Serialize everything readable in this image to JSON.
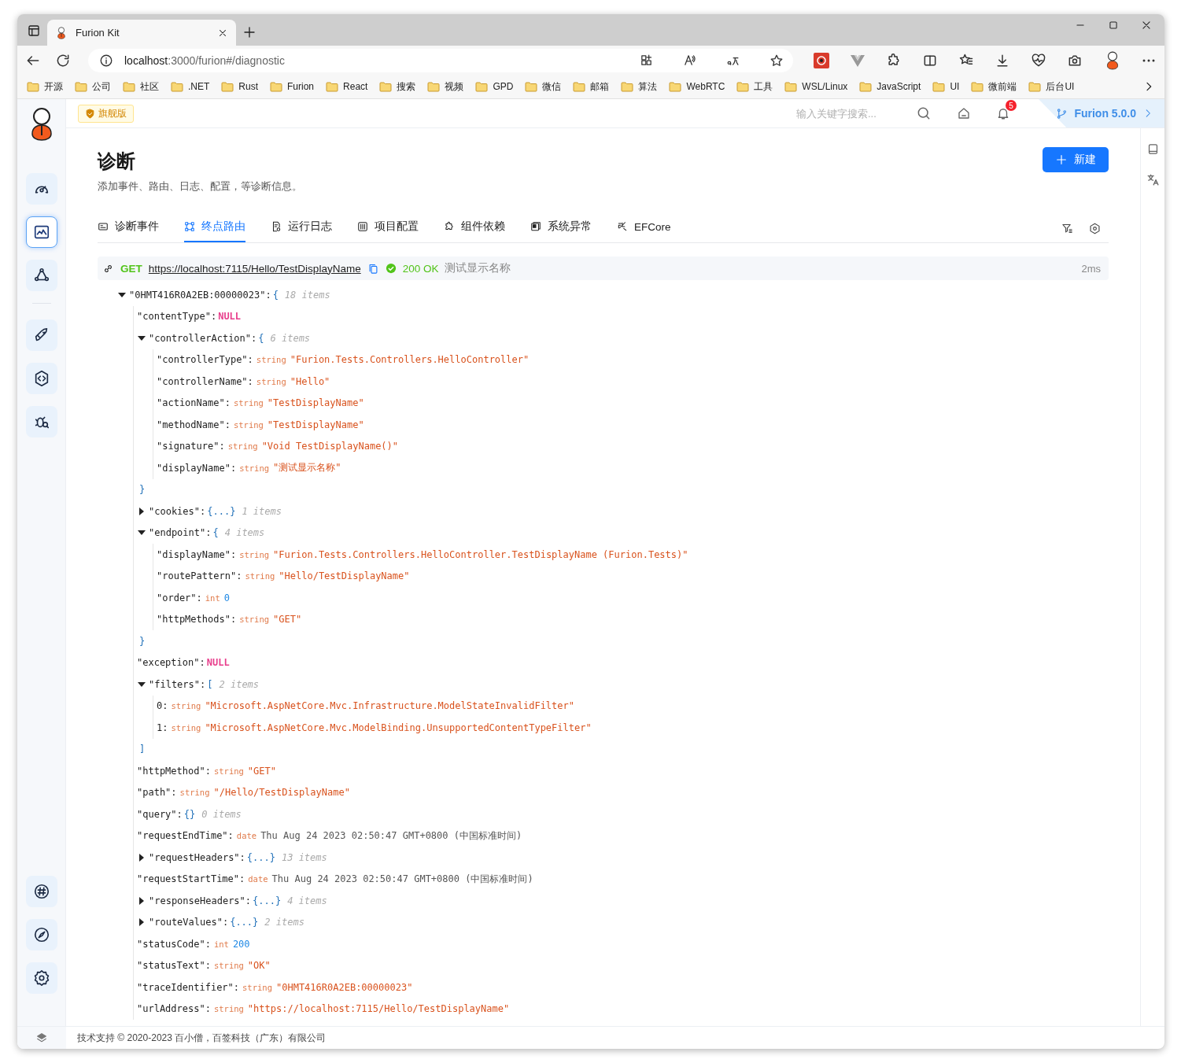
{
  "browser": {
    "tab_title": "Furion Kit",
    "address": {
      "host": "localhost",
      "path": ":3000/furion#/diagnostic"
    },
    "bookmarks": [
      "开源",
      "公司",
      "社区",
      ".NET",
      "Rust",
      "Furion",
      "React",
      "搜索",
      "视频",
      "GPD",
      "微信",
      "邮箱",
      "算法",
      "WebRTC",
      "工具",
      "WSL/Linux",
      "JavaScript",
      "UI",
      "微前端",
      "后台UI"
    ]
  },
  "sidebar": {
    "items": [
      {
        "kind": "gauge",
        "selected": false
      },
      {
        "kind": "chart",
        "selected": true
      },
      {
        "kind": "nodes",
        "selected": false
      },
      {
        "kind": "rocket",
        "selected": false
      },
      {
        "kind": "code",
        "selected": false
      },
      {
        "kind": "bug",
        "selected": false
      }
    ],
    "bottom_items": [
      {
        "kind": "hash",
        "selected": false
      },
      {
        "kind": "compass",
        "selected": false
      },
      {
        "kind": "gear",
        "selected": false
      }
    ]
  },
  "header": {
    "edition_badge": "旗舰版",
    "search": {
      "placeholder": "输入关键字搜索..."
    },
    "notification_count": "5",
    "version": "Furion 5.0.0"
  },
  "page": {
    "title": "诊断",
    "subtitle": "添加事件、路由、日志、配置，等诊断信息。",
    "new_button": "新建"
  },
  "tabs": [
    {
      "label": "诊断事件",
      "kind": "event",
      "selected": false
    },
    {
      "label": "终点路由",
      "kind": "route",
      "selected": true
    },
    {
      "label": "运行日志",
      "kind": "log",
      "selected": false
    },
    {
      "label": "项目配置",
      "kind": "config",
      "selected": false
    },
    {
      "label": "组件依赖",
      "kind": "puzzle",
      "selected": false
    },
    {
      "label": "系统异常",
      "kind": "error",
      "selected": false
    },
    {
      "label": "EFCore",
      "kind": "sql",
      "selected": false
    }
  ],
  "request": {
    "method": "GET",
    "url": "https://localhost:7115/Hello/TestDisplayName",
    "status": "200 OK",
    "name": "测试显示名称",
    "duration": "2ms"
  },
  "tree": {
    "key": "\"0HMT416R0A2EB:00000023\":",
    "kind": "object",
    "expanded": true,
    "open": "{",
    "count": "18 items",
    "children": [
      {
        "key": "\"contentType\":",
        "kind": "null",
        "value": "NULL"
      },
      {
        "key": "\"controllerAction\":",
        "kind": "object",
        "expanded": true,
        "open": "{",
        "count": "6 items",
        "close": "}",
        "children": [
          {
            "key": "\"controllerType\":",
            "kind": "string",
            "type": "string",
            "value": "\"Furion.Tests.Controllers.HelloController\""
          },
          {
            "key": "\"controllerName\":",
            "kind": "string",
            "type": "string",
            "value": "\"Hello\""
          },
          {
            "key": "\"actionName\":",
            "kind": "string",
            "type": "string",
            "value": "\"TestDisplayName\""
          },
          {
            "key": "\"methodName\":",
            "kind": "string",
            "type": "string",
            "value": "\"TestDisplayName\""
          },
          {
            "key": "\"signature\":",
            "kind": "string",
            "type": "string",
            "value": "\"Void TestDisplayName()\""
          },
          {
            "key": "\"displayName\":",
            "kind": "string",
            "type": "string",
            "value": "\"测试显示名称\""
          }
        ]
      },
      {
        "key": "\"cookies\":",
        "kind": "object",
        "expanded": false,
        "summary": "{...}",
        "count": "1 items"
      },
      {
        "key": "\"endpoint\":",
        "kind": "object",
        "expanded": true,
        "open": "{",
        "count": "4 items",
        "close": "}",
        "children": [
          {
            "key": "\"displayName\":",
            "kind": "string",
            "type": "string",
            "value": "\"Furion.Tests.Controllers.HelloController.TestDisplayName (Furion.Tests)\""
          },
          {
            "key": "\"routePattern\":",
            "kind": "string",
            "type": "string",
            "value": "\"Hello/TestDisplayName\""
          },
          {
            "key": "\"order\":",
            "kind": "int",
            "type": "int",
            "value": "0"
          },
          {
            "key": "\"httpMethods\":",
            "kind": "string",
            "type": "string",
            "value": "\"GET\""
          }
        ]
      },
      {
        "key": "\"exception\":",
        "kind": "null",
        "value": "NULL"
      },
      {
        "key": "\"filters\":",
        "kind": "array",
        "expanded": true,
        "open": "[",
        "count": "2 items",
        "close": "]",
        "children": [
          {
            "key": "0:",
            "kind": "string",
            "type": "string",
            "value": "\"Microsoft.AspNetCore.Mvc.Infrastructure.ModelStateInvalidFilter\""
          },
          {
            "key": "1:",
            "kind": "string",
            "type": "string",
            "value": "\"Microsoft.AspNetCore.Mvc.ModelBinding.UnsupportedContentTypeFilter\""
          }
        ]
      },
      {
        "key": "\"httpMethod\":",
        "kind": "string",
        "type": "string",
        "value": "\"GET\""
      },
      {
        "key": "\"path\":",
        "kind": "string",
        "type": "string",
        "value": "\"/Hello/TestDisplayName\""
      },
      {
        "key": "\"query\":",
        "kind": "empty",
        "summary": "{}",
        "count": "0 items"
      },
      {
        "key": "\"requestEndTime\":",
        "kind": "date",
        "type": "date",
        "value": "Thu Aug 24 2023 02:50:47 GMT+0800 (中国标准时间)"
      },
      {
        "key": "\"requestHeaders\":",
        "kind": "object",
        "expanded": false,
        "summary": "{...}",
        "count": "13 items"
      },
      {
        "key": "\"requestStartTime\":",
        "kind": "date",
        "type": "date",
        "value": "Thu Aug 24 2023 02:50:47 GMT+0800 (中国标准时间)"
      },
      {
        "key": "\"responseHeaders\":",
        "kind": "object",
        "expanded": false,
        "summary": "{...}",
        "count": "4 items"
      },
      {
        "key": "\"routeValues\":",
        "kind": "object",
        "expanded": false,
        "summary": "{...}",
        "count": "2 items"
      },
      {
        "key": "\"statusCode\":",
        "kind": "int",
        "type": "int",
        "value": "200"
      },
      {
        "key": "\"statusText\":",
        "kind": "string",
        "type": "string",
        "value": "\"OK\""
      },
      {
        "key": "\"traceIdentifier\":",
        "kind": "string",
        "type": "string",
        "value": "\"0HMT416R0A2EB:00000023\""
      },
      {
        "key": "\"urlAddress\":",
        "kind": "string",
        "type": "string",
        "value": "\"https://localhost:7115/Hello/TestDisplayName\""
      }
    ]
  },
  "footer": {
    "text": "技术支持 © 2020-2023 百小僧，百签科技（广东）有限公司"
  }
}
